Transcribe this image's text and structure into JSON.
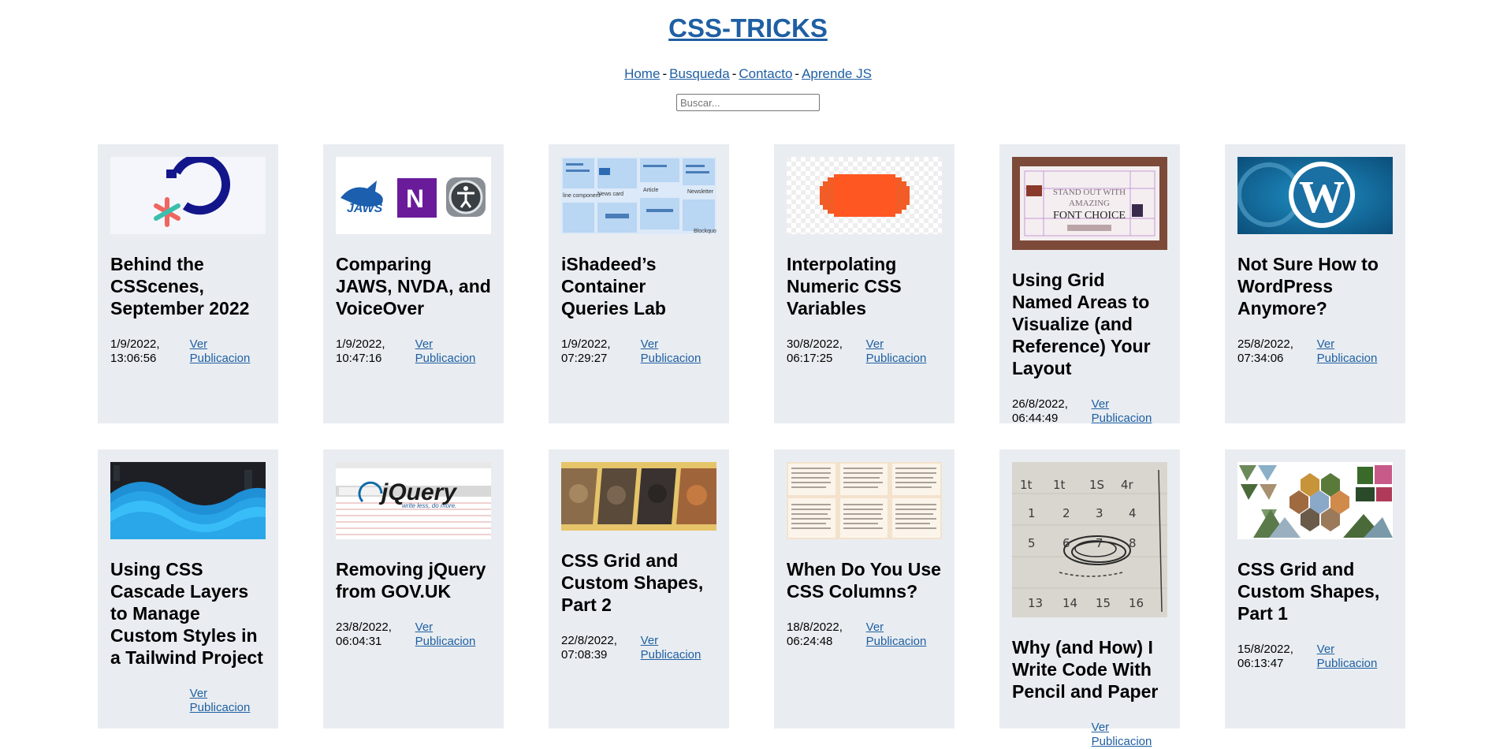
{
  "site": {
    "title": "CSS-TRICKS",
    "nav": [
      "Home",
      "Busqueda",
      "Contacto",
      "Aprende JS"
    ],
    "nav_separator": "-",
    "search_placeholder": "Buscar..."
  },
  "link_label": "Ver Publicacion",
  "posts": [
    {
      "title": "Behind the CSScenes, September 2022",
      "date": "1/9/2022, 13:06:56",
      "thumb": "csscenes-logo"
    },
    {
      "title": "Comparing JAWS, NVDA, and VoiceOver",
      "date": "1/9/2022, 10:47:16",
      "thumb": "screen-reader-logos"
    },
    {
      "title": "iShadeed’s Container Queries Lab",
      "date": "1/9/2022, 07:29:27",
      "thumb": "container-queries-cards"
    },
    {
      "title": "Interpolating Numeric CSS Variables",
      "date": "30/8/2022, 06:17:25",
      "thumb": "orange-shape"
    },
    {
      "title": "Using Grid Named Areas to Visualize (and Reference) Your Layout",
      "date": "26/8/2022, 06:44:49",
      "thumb": "grid-areas-layout",
      "thumb_text": [
        "STAND OUT WITH",
        "AMAZING",
        "FONT CHOICE"
      ]
    },
    {
      "title": "Not Sure How to WordPress Anymore?",
      "date": "25/8/2022, 07:34:06",
      "thumb": "wordpress-logo"
    },
    {
      "title": "Using CSS Cascade Layers to Manage Custom Styles in a Tailwind Project",
      "date": "",
      "thumb": "tailwind-waves"
    },
    {
      "title": "Removing jQuery from GOV.UK",
      "date": "23/8/2022, 06:04:31",
      "thumb": "jquery-logo",
      "thumb_text": [
        "jQuery",
        "write less, do more."
      ]
    },
    {
      "title": "CSS Grid and Custom Shapes, Part 2",
      "date": "22/8/2022, 07:08:39",
      "thumb": "animal-photos"
    },
    {
      "title": "When Do You Use CSS Columns?",
      "date": "18/8/2022, 06:24:48",
      "thumb": "text-columns"
    },
    {
      "title": "Why (and How) I Write Code With Pencil and Paper",
      "date": "",
      "thumb": "pencil-sketch"
    },
    {
      "title": "CSS Grid and Custom Shapes, Part 1",
      "date": "15/8/2022, 06:13:47",
      "thumb": "hexagon-photos"
    }
  ],
  "colors": {
    "link": "#1f5fa3",
    "card_bg": "#e9edf1"
  }
}
